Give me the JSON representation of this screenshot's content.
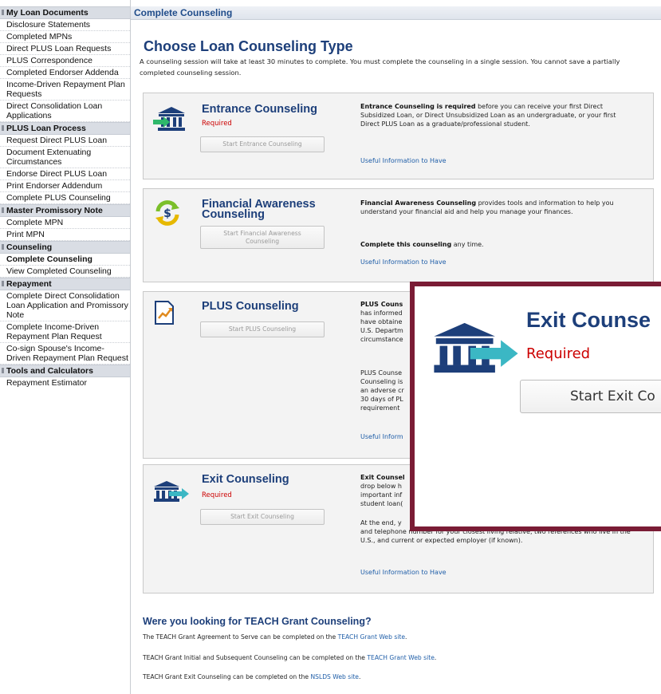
{
  "sidebar": {
    "sections": [
      {
        "title": "My Loan Documents",
        "items": [
          "Disclosure Statements",
          "Completed MPNs",
          "Direct PLUS Loan Requests",
          "PLUS Correspondence",
          "Completed Endorser Addenda",
          "Income-Driven Repayment Plan Requests",
          "Direct Consolidation Loan Applications"
        ]
      },
      {
        "title": "PLUS Loan Process",
        "items": [
          "Request Direct PLUS Loan",
          "Document Extenuating Circumstances",
          "Endorse Direct PLUS Loan",
          "Print Endorser Addendum",
          "Complete PLUS Counseling"
        ]
      },
      {
        "title": "Master Promissory Note",
        "items": [
          "Complete MPN",
          "Print MPN"
        ]
      },
      {
        "title": "Counseling",
        "items": [
          "Complete Counseling",
          "View Completed Counseling"
        ]
      },
      {
        "title": "Repayment",
        "items": [
          "Complete Direct Consolidation Loan Application and Promissory Note",
          "Complete Income-Driven Repayment Plan Request",
          "Co-sign Spouse's Income-Driven Repayment Plan Request"
        ]
      },
      {
        "title": "Tools and Calculators",
        "items": [
          "Repayment Estimator"
        ]
      }
    ]
  },
  "header": {
    "title": "Complete Counseling"
  },
  "main": {
    "title": "Choose Loan Counseling Type",
    "intro": "A counseling session will take at least 30 minutes to complete. You must complete the counseling in a single session. You cannot save a partially completed counseling session.",
    "useful_link": "Useful Information to Have"
  },
  "cards": {
    "entrance": {
      "title": "Entrance Counseling",
      "required": "Required",
      "button": "Start Entrance Counseling",
      "desc_bold": "Entrance Counseling is required",
      "desc_rest": " before you can receive your first Direct Subsidized Loan, or Direct Unsubsidized Loan as an undergraduate, or your first Direct PLUS Loan as a graduate/professional student."
    },
    "financial": {
      "title": "Financial Awareness Counseling",
      "button": "Start Financial Awareness Counseling",
      "desc_bold": "Financial Awareness Counseling",
      "desc_rest": " provides tools and information to help you understand your financial aid and help you manage your finances.",
      "desc2_bold": "Complete this counseling",
      "desc2_rest": " any time."
    },
    "plus": {
      "title": "PLUS Counseling",
      "button": "Start PLUS Counseling",
      "desc_bold": "PLUS Couns",
      "desc_lines": [
        "has informed",
        "have obtaine",
        "U.S. Departm",
        "circumstance"
      ],
      "desc2_lines": [
        "PLUS Counse",
        "Counseling is",
        "an adverse cr",
        "30 days of PL",
        "requirement"
      ],
      "useful_partial": "Useful Inform"
    },
    "exit": {
      "title": "Exit Counseling",
      "required": "Required",
      "button": "Start Exit Counseling",
      "desc_bold": "Exit Counsel",
      "desc_lines": [
        "drop below h",
        "important inf",
        "student loan("
      ],
      "desc2_line1": "At the end, y",
      "desc2_rest": "and telephone number for your closest living relative, two references who live in the U.S., and current or expected employer (if known)."
    }
  },
  "teach": {
    "title": "Were you looking for TEACH Grant Counseling?",
    "line1_pre": "The TEACH Grant Agreement to Serve can be completed on the ",
    "line1_link": "TEACH Grant Web site",
    "line2_pre": "TEACH Grant Initial and Subsequent Counseling can be completed on the ",
    "line2_link": "TEACH Grant Web site",
    "line3_pre": "TEACH Grant Exit Counseling can be completed on the ",
    "line3_link": "NSLDS Web site",
    "period": "."
  },
  "zoom": {
    "title": "Exit Counse",
    "required": "Required",
    "button": "Start Exit Co"
  },
  "colors": {
    "brand_blue": "#1d3f7a",
    "link_blue": "#1f5ea8",
    "required_red": "#cc0000",
    "zoom_border": "#7a1c35"
  },
  "icons": {
    "entrance": "bank-arrow-in-icon",
    "financial": "dollar-cycle-icon",
    "plus": "chart-document-icon",
    "exit": "bank-arrow-out-icon"
  }
}
